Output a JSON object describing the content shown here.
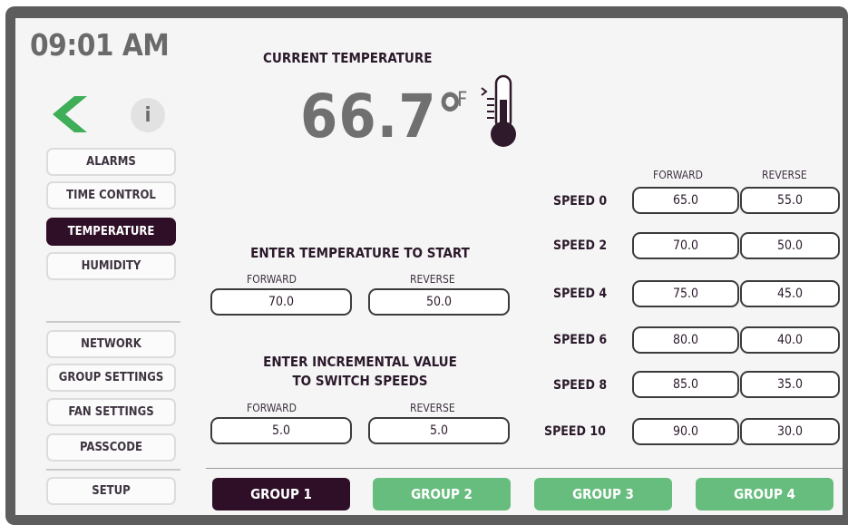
{
  "clock": {
    "time": "09:01 AM"
  },
  "nav": {
    "items": [
      {
        "label": "ALARMS",
        "active": false
      },
      {
        "label": "TIME CONTROL",
        "active": false
      },
      {
        "label": "TEMPERATURE",
        "active": true
      },
      {
        "label": "HUMIDITY",
        "active": false
      },
      {
        "label": "NETWORK",
        "active": false
      },
      {
        "label": "GROUP SETTINGS",
        "active": false
      },
      {
        "label": "FAN SETTINGS",
        "active": false
      },
      {
        "label": "PASSCODE",
        "active": false
      },
      {
        "label": "SETUP",
        "active": false
      }
    ],
    "back_icon": "chevron-left-icon",
    "info_icon": "info-icon",
    "info_glyph": "i"
  },
  "current": {
    "title": "CURRENT TEMPERATURE",
    "value": "66.7°",
    "unit": "F",
    "icon": "thermometer-icon"
  },
  "start": {
    "title": "ENTER TEMPERATURE TO START",
    "forward_label": "FORWARD",
    "reverse_label": "REVERSE",
    "forward_value": "70.0",
    "reverse_value": "50.0"
  },
  "increment": {
    "title_line1": "ENTER INCREMENTAL VALUE",
    "title_line2": "TO SWITCH SPEEDS",
    "forward_label": "FORWARD",
    "reverse_label": "REVERSE",
    "forward_value": "5.0",
    "reverse_value": "5.0"
  },
  "speeds": {
    "forward_header": "FORWARD",
    "reverse_header": "REVERSE",
    "rows": [
      {
        "label": "SPEED 0",
        "forward": "65.0",
        "reverse": "55.0"
      },
      {
        "label": "SPEED 2",
        "forward": "70.0",
        "reverse": "50.0"
      },
      {
        "label": "SPEED 4",
        "forward": "75.0",
        "reverse": "45.0"
      },
      {
        "label": "SPEED 6",
        "forward": "80.0",
        "reverse": "40.0"
      },
      {
        "label": "SPEED 8",
        "forward": "85.0",
        "reverse": "35.0"
      },
      {
        "label": "SPEED 10",
        "forward": "90.0",
        "reverse": "30.0"
      }
    ]
  },
  "groups": [
    {
      "label": "GROUP 1",
      "active": true
    },
    {
      "label": "GROUP 2",
      "active": false
    },
    {
      "label": "GROUP 3",
      "active": false
    },
    {
      "label": "GROUP 4",
      "active": false
    }
  ],
  "colors": {
    "active_nav": "#2e0f27",
    "group_inactive": "#67bd7e",
    "back_arrow": "#3fae59",
    "frame": "#5d5d5d"
  }
}
